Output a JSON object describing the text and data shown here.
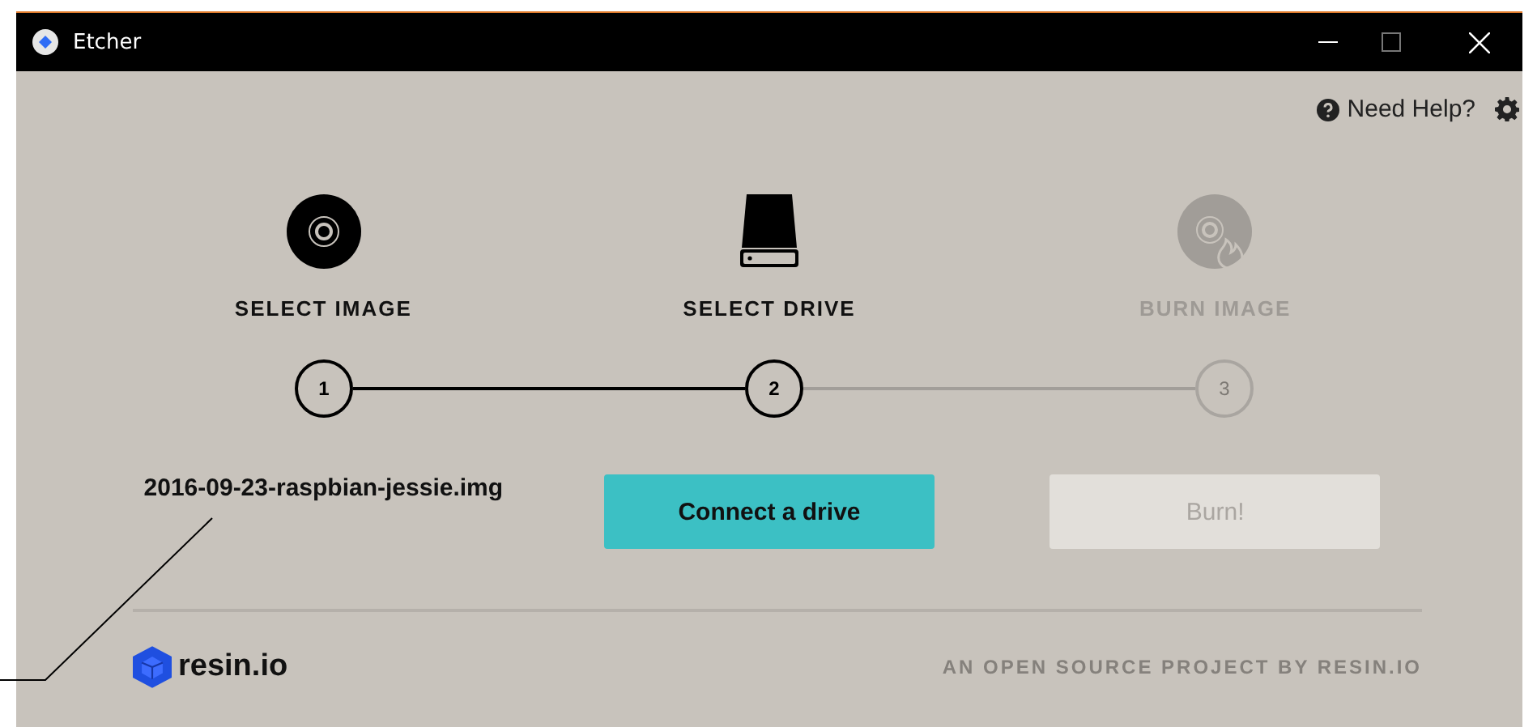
{
  "window": {
    "title": "Etcher"
  },
  "header": {
    "help_link": "Need Help?"
  },
  "steps": [
    {
      "kind": "image",
      "label": "SELECT IMAGE",
      "number": "1",
      "disabled": false
    },
    {
      "kind": "drive",
      "label": "SELECT DRIVE",
      "number": "2",
      "disabled": false
    },
    {
      "kind": "burn",
      "label": "BURN IMAGE",
      "number": "3",
      "disabled": true
    }
  ],
  "selected_image": "2016-09-23-raspbian-jessie.img",
  "actions": [
    {
      "label": "Connect a drive",
      "disabled": false
    },
    {
      "label": "Burn!",
      "disabled": true
    }
  ],
  "footer": {
    "logo_text": "resin.io",
    "credit": "AN OPEN SOURCE PROJECT BY RESIN.IO"
  }
}
